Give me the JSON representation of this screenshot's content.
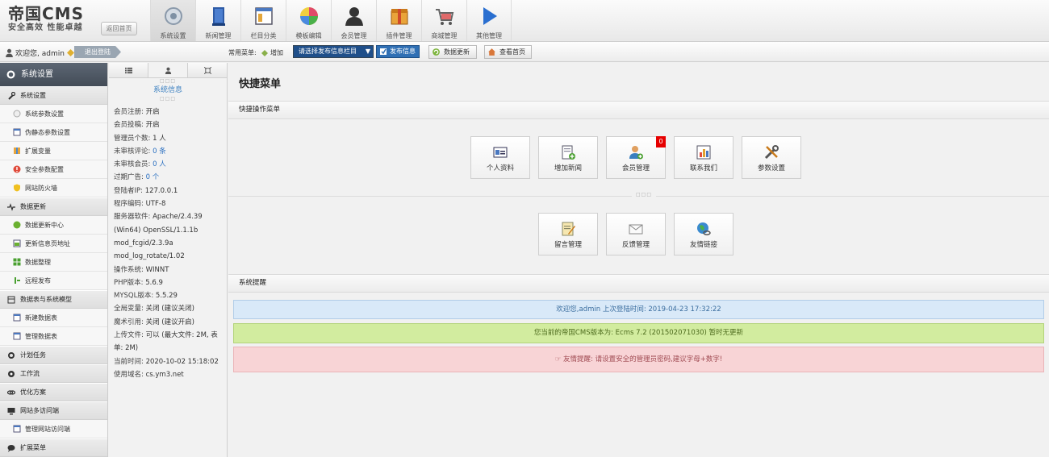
{
  "header": {
    "logo_line1": "帝国CMS",
    "logo_line2": "安全高效 性能卓越",
    "back_home": "返回首页",
    "nav": [
      {
        "label": "系统设置",
        "icon": "gear-icon"
      },
      {
        "label": "新闻管理",
        "icon": "book-icon"
      },
      {
        "label": "栏目分类",
        "icon": "window-icon"
      },
      {
        "label": "模板编辑",
        "icon": "palette-icon"
      },
      {
        "label": "会员管理",
        "icon": "user-icon"
      },
      {
        "label": "插件管理",
        "icon": "plugin-box-icon"
      },
      {
        "label": "商城管理",
        "icon": "cart-icon"
      },
      {
        "label": "其他管理",
        "icon": "play-icon"
      }
    ]
  },
  "toolbar": {
    "welcome": "欢迎您, admin",
    "logout": "退出登陆",
    "common_menu": "常用菜单:",
    "add": "增加",
    "publish_select": "请选择发布信息栏目",
    "publish_button": "发布信息",
    "data_update": "数据更新",
    "view_home": "查看首页"
  },
  "sidebar": {
    "title": "系统设置",
    "groups": [
      {
        "label": "系统设置",
        "items": [
          "系统参数设置",
          "伪静态参数设置",
          "扩展变量",
          "安全参数配置",
          "网站防火墙"
        ]
      },
      {
        "label": "数据更新",
        "items": [
          "数据更新中心",
          "更新信息页地址",
          "数据整理",
          "远程发布"
        ]
      },
      {
        "label": "数据表与系统模型",
        "items": [
          "新建数据表",
          "管理数据表"
        ]
      },
      {
        "label": "计划任务",
        "items": []
      },
      {
        "label": "工作流",
        "items": []
      },
      {
        "label": "优化方案",
        "items": []
      },
      {
        "label": "网站多访问端",
        "items": [
          "管理网站访问端"
        ]
      },
      {
        "label": "扩展菜单",
        "items": []
      }
    ]
  },
  "info_panel": {
    "title": "系统信息",
    "lines": [
      {
        "label": "会员注册:",
        "value": "开启"
      },
      {
        "label": "会员投稿:",
        "value": "开启"
      },
      {
        "label": "管理员个数:",
        "value": "1 人",
        "blue": "1"
      },
      {
        "label": "未审核评论:",
        "value": "0 条"
      },
      {
        "label": "未审核会员:",
        "value": "0 人"
      },
      {
        "label": "过期广告:",
        "value": "0 个"
      },
      {
        "label": "登陆者IP:",
        "value": "127.0.0.1"
      },
      {
        "label": "程序编码:",
        "value": "UTF-8"
      },
      {
        "label": "服务器软件:",
        "value": "Apache/2.4.39"
      },
      {
        "label": "",
        "value": "(Win64) OpenSSL/1.1.1b"
      },
      {
        "label": "",
        "value": "mod_fcgid/2.3.9a"
      },
      {
        "label": "",
        "value": "mod_log_rotate/1.02"
      },
      {
        "label": "操作系统:",
        "value": "WINNT"
      },
      {
        "label": "PHP版本:",
        "value": "5.6.9"
      },
      {
        "label": "MYSQL版本:",
        "value": "5.5.29"
      },
      {
        "label": "全局变量:",
        "value": "关闭 (建议关闭)"
      },
      {
        "label": "魔术引用:",
        "value": "关闭 (建议开启)"
      },
      {
        "label": "上传文件:",
        "value": "可以 (最大文件: 2M, 表单: 2M)"
      },
      {
        "label": "当前时间:",
        "value": "2020-10-02 15:18:02"
      },
      {
        "label": "使用域名:",
        "value": "cs.ym3.net"
      }
    ]
  },
  "main": {
    "title": "快捷菜单",
    "quick_section": "快捷操作菜单",
    "quick_row1": [
      {
        "label": "个人资料",
        "icon": "id-card-icon"
      },
      {
        "label": "增加新闻",
        "icon": "add-document-icon"
      },
      {
        "label": "会员管理",
        "icon": "add-user-icon",
        "badge": "0"
      },
      {
        "label": "联系我们",
        "icon": "contact-chart-icon"
      },
      {
        "label": "参数设置",
        "icon": "tools-icon"
      }
    ],
    "quick_row2": [
      {
        "label": "留言管理",
        "icon": "note-edit-icon"
      },
      {
        "label": "反馈管理",
        "icon": "envelope-icon"
      },
      {
        "label": "友情链接",
        "icon": "globe-link-icon"
      }
    ],
    "notice_section": "系统提醒",
    "notice_login": "欢迎您,admin 上次登陆时间: 2019-04-23 17:32:22",
    "notice_version": "您当前的帝国CMS版本为: Ecms 7.2 (201502071030) 暂时无更新",
    "notice_pass": "☞ 友情提醒: 请设置安全的管理员密码,建议字母+数字!"
  },
  "colors": {
    "sidebar_title_bg": "#4a535e",
    "publish_blue": "#1f4f8a",
    "badge_red": "#e60000",
    "notice_blue": "#d9e9f8",
    "notice_green": "#d2ec9f",
    "notice_pink": "#f8d4d6"
  }
}
